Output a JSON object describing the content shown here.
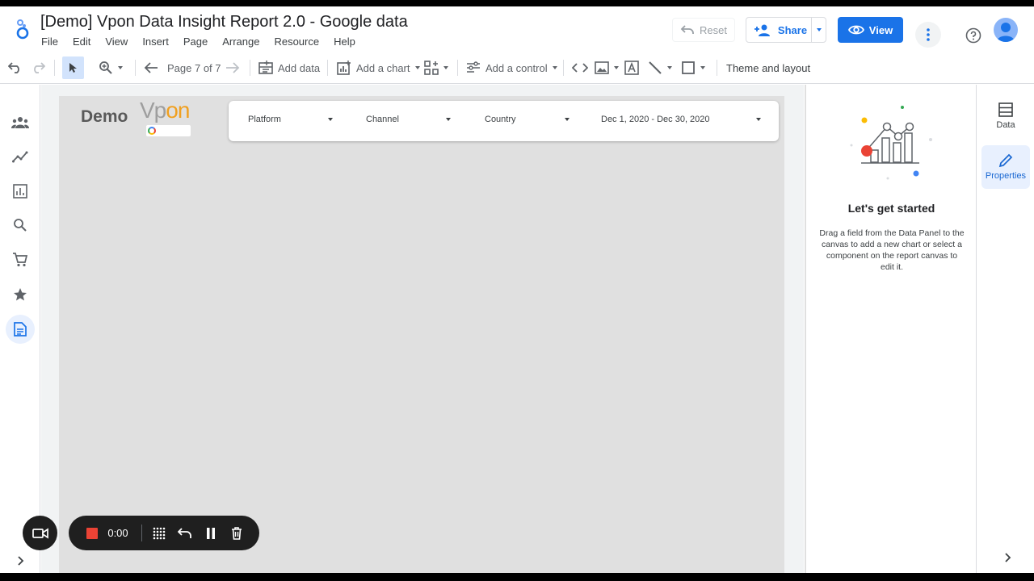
{
  "header": {
    "title": "[Demo] Vpon Data Insight Report 2.0 - Google data",
    "menu": [
      "File",
      "Edit",
      "View",
      "Insert",
      "Page",
      "Arrange",
      "Resource",
      "Help"
    ],
    "reset_label": "Reset",
    "share_label": "Share",
    "view_label": "View"
  },
  "toolbar": {
    "page_indicator": "Page 7 of 7",
    "add_data_label": "Add data",
    "add_chart_label": "Add a chart",
    "add_control_label": "Add a control",
    "theme_label": "Theme and layout"
  },
  "report": {
    "logo_demo": "Demo",
    "logo_vpon_v": "Vp",
    "logo_vpon_on": "on",
    "filters": [
      {
        "label": "Platform"
      },
      {
        "label": "Channel"
      },
      {
        "label": "Country"
      },
      {
        "label": "Dec 1, 2020 - Dec 30, 2020"
      }
    ]
  },
  "properties_panel": {
    "title": "Let's get started",
    "text": "Drag a field from the Data Panel to the canvas to add a new chart or select a component on the report canvas to edit it."
  },
  "right_rail": {
    "data_label": "Data",
    "properties_label": "Properties"
  },
  "left_rail": {
    "icons": [
      "people-icon",
      "insights-icon",
      "report-icon",
      "search-icon",
      "cart-icon",
      "star-icon",
      "document-icon"
    ]
  },
  "recorder": {
    "time": "0:00"
  },
  "colors": {
    "accent": "#1a73e8",
    "canvas": "#e0e0e0",
    "vpon_orange": "#f0a020",
    "record_red": "#ea4335"
  }
}
